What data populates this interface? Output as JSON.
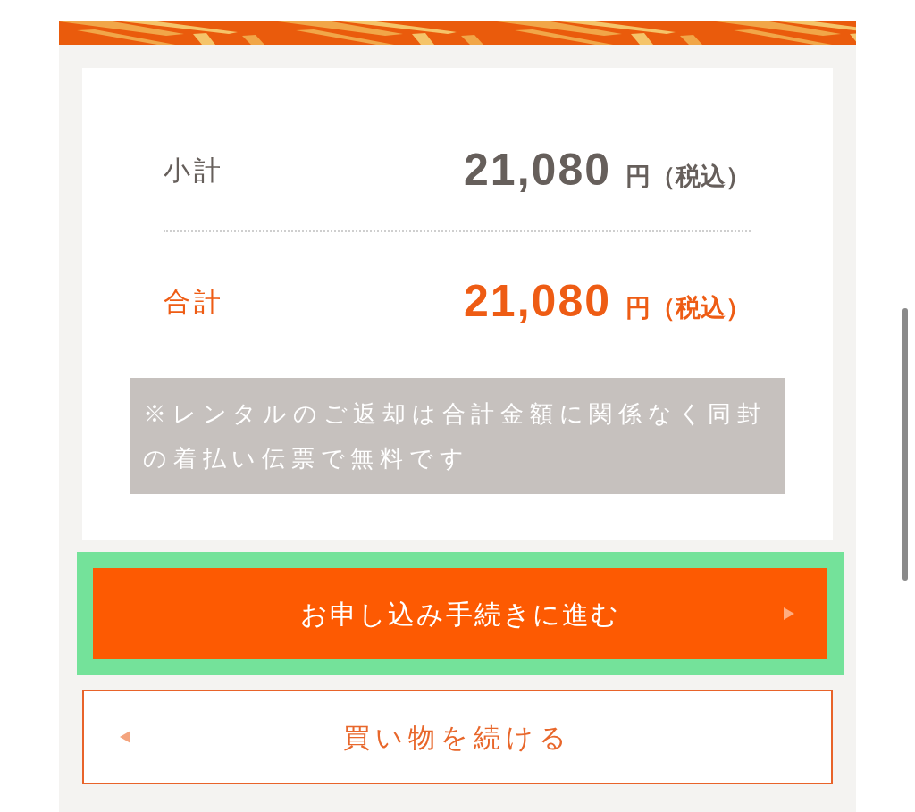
{
  "summary": {
    "rows": [
      {
        "kind": "subtotal",
        "label": "小計",
        "amount": "21,080",
        "suffix": "円（税込）"
      },
      {
        "kind": "total",
        "label": "合計",
        "amount": "21,080",
        "suffix": "円（税込）"
      }
    ],
    "note": "※レンタルのご返却は合計金額に関係なく同封の着払い伝票で無料です"
  },
  "buttons": [
    {
      "kind": "primary",
      "label": "お申し込み手続きに進む",
      "highlighted": true
    },
    {
      "kind": "secondary",
      "label": "買い物を続ける",
      "highlighted": false
    }
  ]
}
